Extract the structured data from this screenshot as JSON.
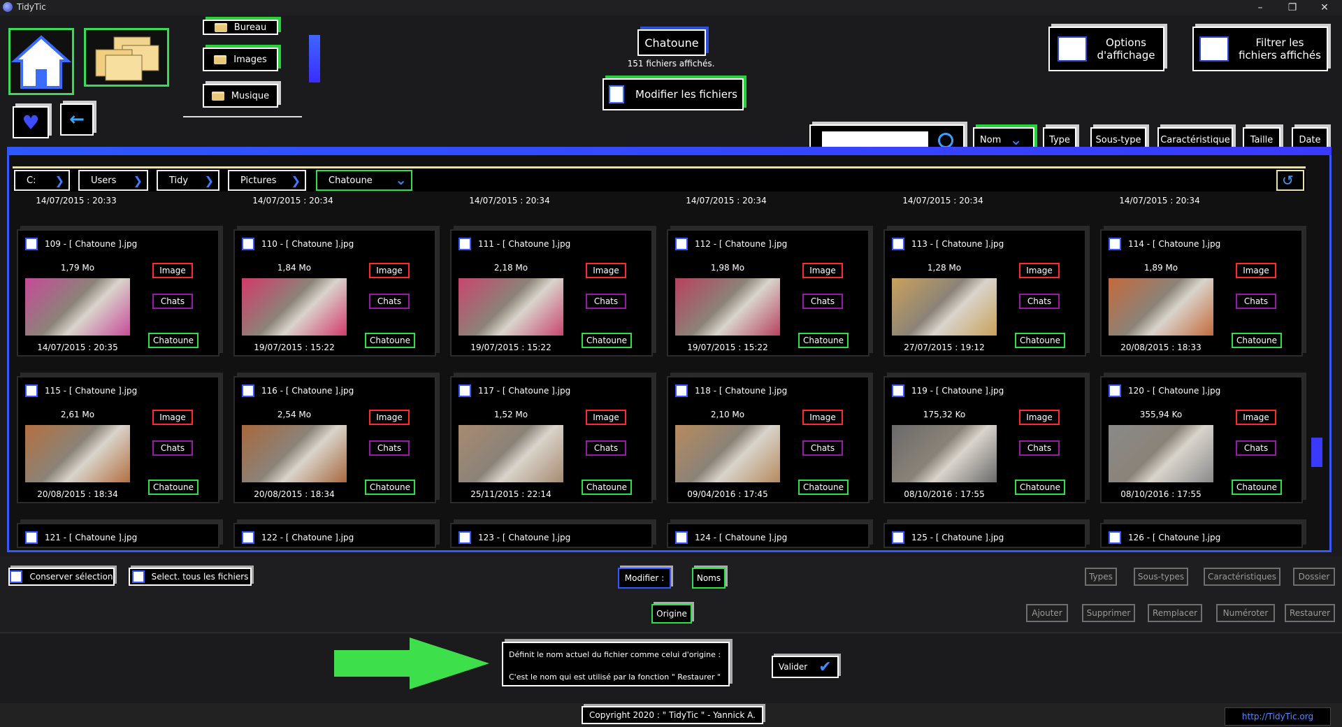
{
  "window": {
    "title": "TidyTic",
    "min": "–",
    "max": "❐",
    "close": "✕"
  },
  "header": {
    "folders": [
      "Bureau",
      "Images",
      "Musique"
    ],
    "current_folder": "Chatoune",
    "count_text": "151 fichiers affichés.",
    "modify_files": "Modifier les fichiers",
    "options_label_1": "Options",
    "options_label_2": "d'affichage",
    "filter_label_1": "Filtrer les",
    "filter_label_2": "fichiers affichés"
  },
  "sort_buttons": [
    "Nom",
    "Type",
    "Sous-type",
    "Caractéristique",
    "Taille",
    "Date"
  ],
  "search": {
    "value": "",
    "placeholder": ""
  },
  "breadcrumb": [
    "C:",
    "Users",
    "Tidy",
    "Pictures",
    "Chatoune"
  ],
  "top_dates": [
    "14/07/2015 : 20:33",
    "14/07/2015 : 20:34",
    "14/07/2015 : 20:34",
    "14/07/2015 : 20:34",
    "14/07/2015 : 20:34",
    "14/07/2015 : 20:34"
  ],
  "files": [
    {
      "name": "109 - [ Chatoune ].jpg",
      "size": "1,79 Mo",
      "date": "14/07/2015 : 20:35",
      "tags": [
        "Image",
        "Chats",
        "Chatoune"
      ],
      "color": "#c84a9a"
    },
    {
      "name": "110 - [ Chatoune ].jpg",
      "size": "1,84 Mo",
      "date": "19/07/2015 : 15:22",
      "tags": [
        "Image",
        "Chats",
        "Chatoune"
      ],
      "color": "#d23a6a"
    },
    {
      "name": "111 - [ Chatoune ].jpg",
      "size": "2,18 Mo",
      "date": "19/07/2015 : 15:22",
      "tags": [
        "Image",
        "Chats",
        "Chatoune"
      ],
      "color": "#c8466e"
    },
    {
      "name": "112 - [ Chatoune ].jpg",
      "size": "1,98 Mo",
      "date": "19/07/2015 : 15:22",
      "tags": [
        "Image",
        "Chats",
        "Chatoune"
      ],
      "color": "#b8415e"
    },
    {
      "name": "113 - [ Chatoune ].jpg",
      "size": "1,28 Mo",
      "date": "27/07/2015 : 19:12",
      "tags": [
        "Image",
        "Chats",
        "Chatoune"
      ],
      "color": "#c9a15a"
    },
    {
      "name": "114 - [ Chatoune ].jpg",
      "size": "1,89 Mo",
      "date": "20/08/2015 : 18:33",
      "tags": [
        "Image",
        "Chats",
        "Chatoune"
      ],
      "color": "#c46a3c"
    },
    {
      "name": "115 - [ Chatoune ].jpg",
      "size": "2,61 Mo",
      "date": "20/08/2015 : 18:34",
      "tags": [
        "Image",
        "Chats",
        "Chatoune"
      ],
      "color": "#b37040"
    },
    {
      "name": "116 - [ Chatoune ].jpg",
      "size": "2,54 Mo",
      "date": "20/08/2015 : 18:34",
      "tags": [
        "Image",
        "Chats",
        "Chatoune"
      ],
      "color": "#a8683e"
    },
    {
      "name": "117 - [ Chatoune ].jpg",
      "size": "1,52 Mo",
      "date": "25/11/2015 : 22:14",
      "tags": [
        "Image",
        "Chats",
        "Chatoune"
      ],
      "color": "#a88a70"
    },
    {
      "name": "118 - [ Chatoune ].jpg",
      "size": "2,10 Mo",
      "date": "09/04/2016 : 17:45",
      "tags": [
        "Image",
        "Chats",
        "Chatoune"
      ],
      "color": "#b78a5e"
    },
    {
      "name": "119 - [ Chatoune ].jpg",
      "size": "175,32 Ko",
      "date": "08/10/2016 : 17:55",
      "tags": [
        "Image",
        "Chats",
        "Chatoune"
      ],
      "color": "#6a6a6a"
    },
    {
      "name": "120 - [ Chatoune ].jpg",
      "size": "355,94 Ko",
      "date": "08/10/2016 : 17:55",
      "tags": [
        "Image",
        "Chats",
        "Chatoune"
      ],
      "color": "#8a8a8a"
    }
  ],
  "bottom_names": [
    "121 - [ Chatoune ].jpg",
    "122 - [ Chatoune ].jpg",
    "123 - [ Chatoune ].jpg",
    "124 - [ Chatoune ].jpg",
    "125 - [ Chatoune ].jpg",
    "126 - [ Chatoune ].jpg"
  ],
  "actions": {
    "keep_selection": "Conserver sélection",
    "select_all": "Select. tous les fichiers",
    "modify": "Modifier :",
    "names": "Noms",
    "origin": "Origine",
    "types": "Types",
    "subtypes": "Sous-types",
    "characteristics": "Caractéristiques",
    "folder": "Dossier",
    "add": "Ajouter",
    "delete": "Supprimer",
    "replace": "Remplacer",
    "number": "Numéroter",
    "restore": "Restaurer",
    "validate": "Valider"
  },
  "info": {
    "line1": "Définit le nom actuel du fichier comme celui d'origine :",
    "line2": "C'est le nom qui est utilisé par la fonction \" Restaurer \""
  },
  "footer": {
    "copyright": "Copyright 2020 : \" TidyTic \" - Yannick A.",
    "link": "http://TidyTic.org"
  }
}
